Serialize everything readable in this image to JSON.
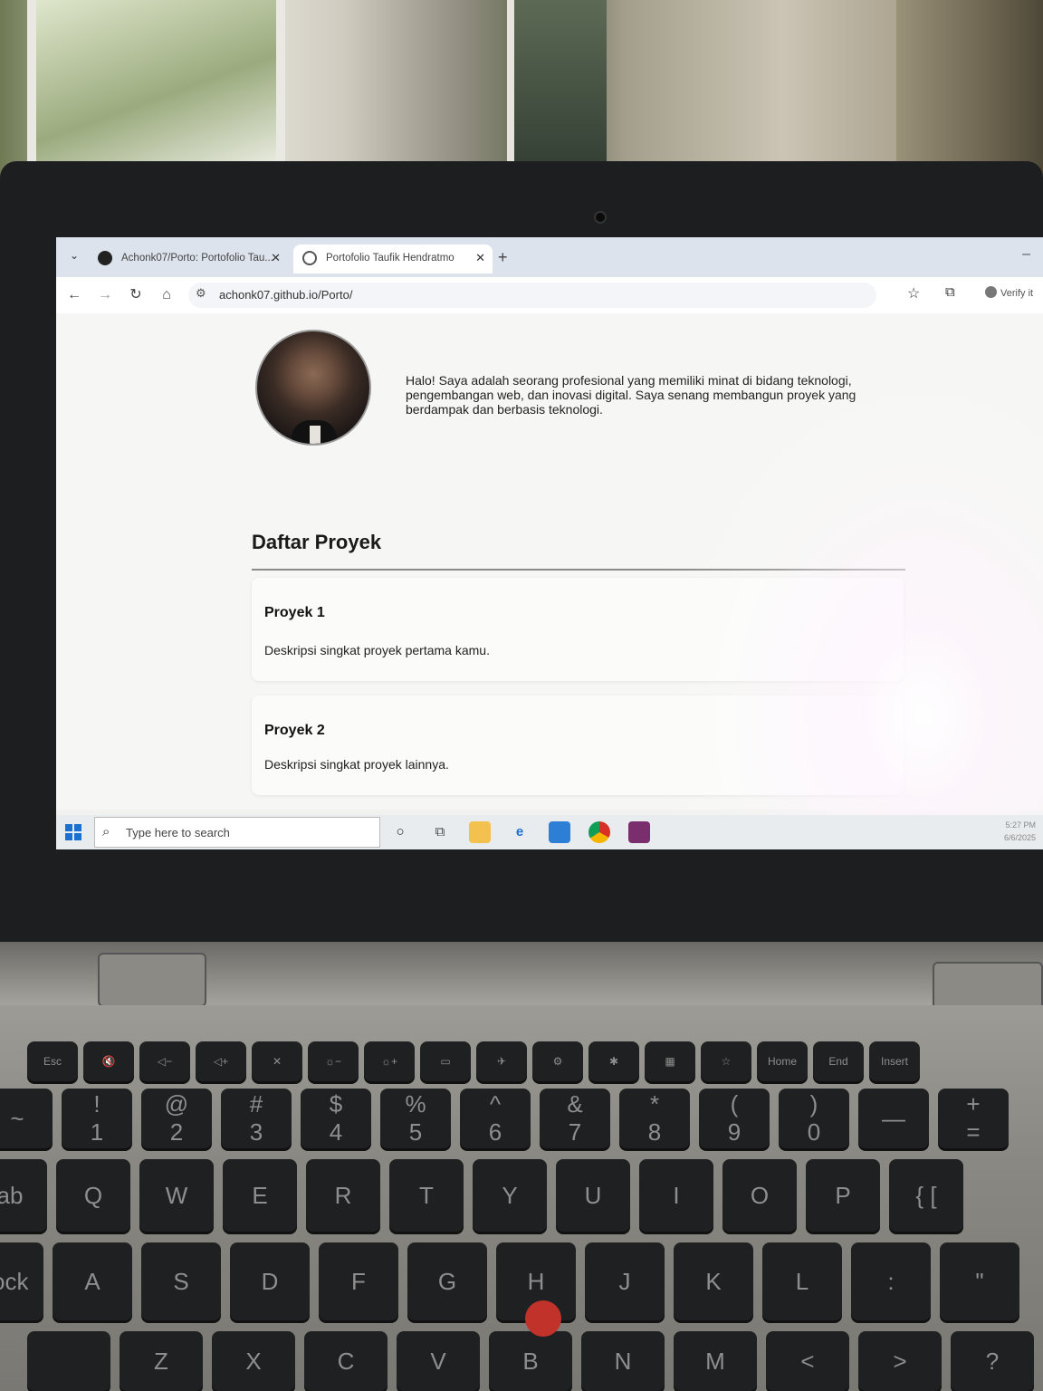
{
  "browser": {
    "tabs": [
      {
        "label": "Achonk07/Porto: Portofolio Tau...",
        "close": "✕"
      },
      {
        "label": "Portofolio Taufik Hendratmo",
        "close": "✕"
      }
    ],
    "new_tab": "+",
    "url": "achonk07.github.io/Porto/",
    "extension_label": "Verify it"
  },
  "page": {
    "intro": "Halo! Saya adalah seorang profesional yang memiliki minat di bidang teknologi, pengembangan web, dan inovasi digital. Saya senang membangun proyek yang berdampak dan berbasis teknologi.",
    "section_title": "Daftar Proyek",
    "projects": [
      {
        "title": "Proyek 1",
        "desc": "Deskripsi singkat proyek pertama kamu."
      },
      {
        "title": "Proyek 2",
        "desc": "Deskripsi singkat proyek lainnya."
      }
    ]
  },
  "taskbar": {
    "search_placeholder": "Type here to search",
    "time": "5:27 PM",
    "date": "6/6/2025",
    "apps": [
      "cortana-icon",
      "task-view-icon",
      "file-explorer-icon",
      "edge-icon",
      "mail-icon",
      "chrome-icon",
      "winrar-icon"
    ]
  },
  "keyboard": {
    "function_row": [
      "Esc",
      "🔇",
      "◁−",
      "◁+",
      "✕",
      "☼−",
      "☼+",
      "▭",
      "✈",
      "⚙",
      "✱",
      "▦",
      "☆",
      "Home",
      "End",
      "Insert"
    ],
    "number_row": [
      "~",
      "!\n1",
      "@\n2",
      "#\n3",
      "$\n4",
      "%\n5",
      "^\n6",
      "&\n7",
      "*\n8",
      "(\n9",
      ")\n0",
      "—",
      "+\n="
    ],
    "row_q": [
      "ab",
      "Q",
      "W",
      "E",
      "R",
      "T",
      "Y",
      "U",
      "I",
      "O",
      "P",
      "{ [",
      "} ]"
    ],
    "row_a": [
      "Lock",
      "A",
      "S",
      "D",
      "F",
      "G",
      "H",
      "J",
      "K",
      "L",
      ":",
      "\""
    ],
    "row_z": [
      "",
      "Z",
      "X",
      "C",
      "V",
      "B",
      "N",
      "M",
      "<",
      ">",
      "?"
    ]
  }
}
